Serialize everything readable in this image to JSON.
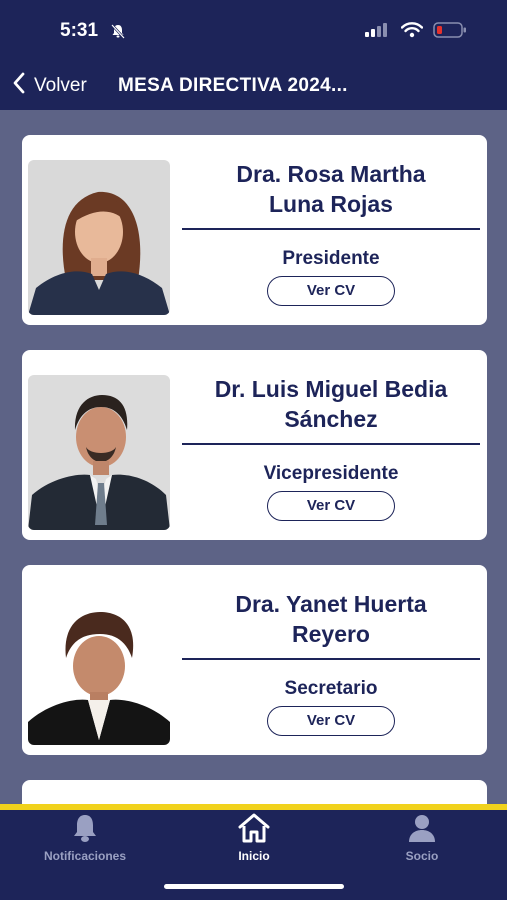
{
  "status_bar": {
    "time": "5:31"
  },
  "header": {
    "back_label": "Volver",
    "title": "MESA DIRECTIVA 2024..."
  },
  "members": [
    {
      "name_line1": "Dra. Rosa Martha",
      "name_line2": "Luna Rojas",
      "role": "Presidente",
      "cv_label": "Ver CV"
    },
    {
      "name_line1": "Dr. Luis Miguel Bedia",
      "name_line2": "Sánchez",
      "role": "Vicepresidente",
      "cv_label": "Ver CV"
    },
    {
      "name_line1": "Dra. Yanet Huerta",
      "name_line2": "Reyero",
      "role": "Secretario",
      "cv_label": "Ver CV"
    }
  ],
  "tabs": [
    {
      "label": "Notificaciones",
      "icon": "bell-icon"
    },
    {
      "label": "Inicio",
      "icon": "home-icon",
      "active": true
    },
    {
      "label": "Socio",
      "icon": "user-icon"
    }
  ],
  "colors": {
    "navy": "#1d2459",
    "background": "#5d6386",
    "accent_yellow": "#f1d21c",
    "battery_low": "#e5322d"
  }
}
